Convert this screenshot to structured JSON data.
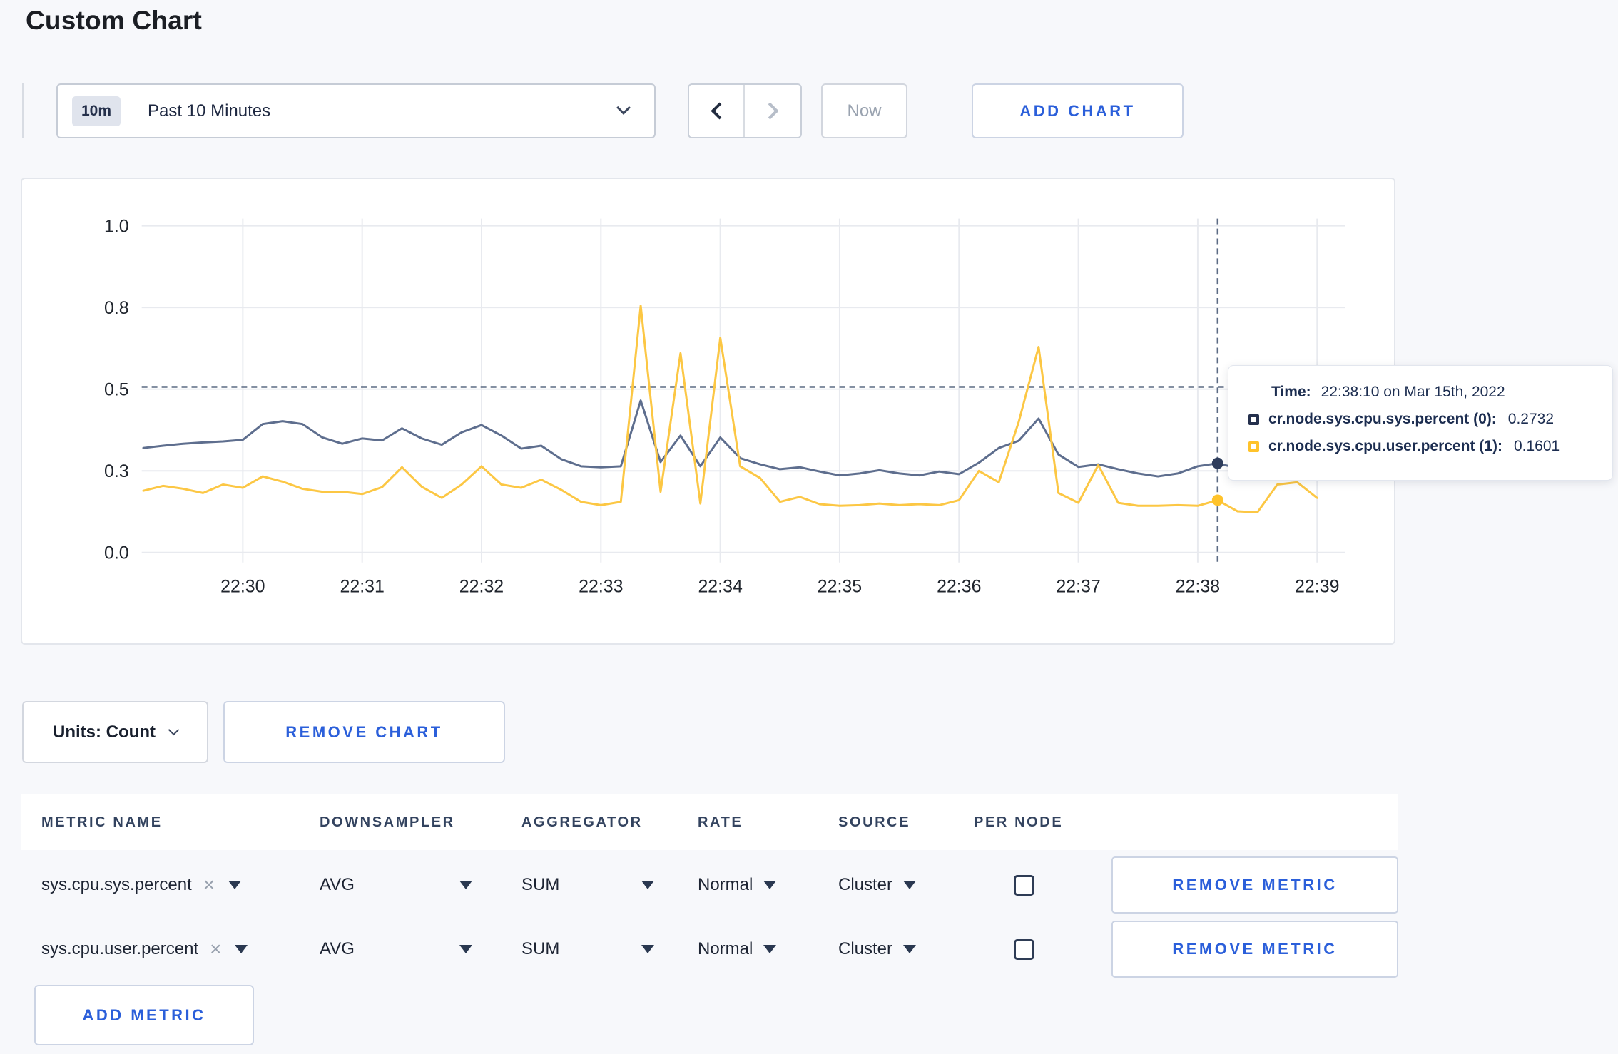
{
  "page": {
    "title": "Custom Chart"
  },
  "toolbar": {
    "time_window_badge": "10m",
    "time_window_label": "Past 10 Minutes",
    "now_label": "Now",
    "add_chart_label": "ADD CHART"
  },
  "chart_controls": {
    "units_label": "Units: Count",
    "remove_chart_label": "REMOVE CHART"
  },
  "tooltip": {
    "time_label": "Time:",
    "time_value": "22:38:10 on Mar 15th, 2022",
    "series": [
      {
        "name": "cr.node.sys.cpu.sys.percent (0):",
        "value": "0.2732",
        "color": "#25304d"
      },
      {
        "name": "cr.node.sys.cpu.user.percent (1):",
        "value": "0.1601",
        "color": "#ffc32b"
      }
    ]
  },
  "chart_data": {
    "type": "line",
    "title": "",
    "xlabel": "",
    "ylabel": "",
    "ylim": [
      0,
      1
    ],
    "grid": true,
    "legend": "tooltip-overlay",
    "x_ticks": [
      "22:30",
      "22:31",
      "22:32",
      "22:33",
      "22:34",
      "22:35",
      "22:36",
      "22:37",
      "22:38",
      "22:39"
    ],
    "y_tick_labels": [
      "0.0",
      "0.3",
      "0.5",
      "0.8",
      "1.0"
    ],
    "y_tick_values": [
      0,
      0.25,
      0.5,
      0.75,
      1.0
    ],
    "x_start": "22:29:10",
    "start_offset_seconds": -50,
    "interval_seconds": 10,
    "series": [
      {
        "name": "cr.node.sys.cpu.sys.percent (0)",
        "color": "#5e6e8e",
        "marker_color": "#2f3d5c",
        "values": [
          0.32,
          0.327,
          0.333,
          0.337,
          0.34,
          0.345,
          0.393,
          0.402,
          0.393,
          0.352,
          0.333,
          0.349,
          0.343,
          0.38,
          0.349,
          0.33,
          0.368,
          0.39,
          0.358,
          0.318,
          0.327,
          0.286,
          0.264,
          0.261,
          0.264,
          0.465,
          0.277,
          0.358,
          0.264,
          0.352,
          0.289,
          0.27,
          0.255,
          0.261,
          0.248,
          0.236,
          0.242,
          0.252,
          0.242,
          0.236,
          0.248,
          0.24,
          0.275,
          0.32,
          0.342,
          0.41,
          0.3,
          0.262,
          0.27,
          0.255,
          0.242,
          0.233,
          0.242,
          0.264,
          0.2732,
          0.258
        ]
      },
      {
        "name": "cr.node.sys.cpu.user.percent (1)",
        "color": "#fcc744",
        "marker_color": "#ffc32b",
        "values": [
          0.189,
          0.204,
          0.195,
          0.182,
          0.208,
          0.198,
          0.233,
          0.217,
          0.195,
          0.186,
          0.186,
          0.179,
          0.2,
          0.261,
          0.201,
          0.167,
          0.208,
          0.264,
          0.208,
          0.198,
          0.223,
          0.192,
          0.155,
          0.145,
          0.155,
          0.755,
          0.186,
          0.61,
          0.15,
          0.657,
          0.264,
          0.228,
          0.155,
          0.17,
          0.148,
          0.143,
          0.145,
          0.15,
          0.145,
          0.148,
          0.145,
          0.16,
          0.25,
          0.215,
          0.4,
          0.629,
          0.182,
          0.152,
          0.268,
          0.152,
          0.143,
          0.143,
          0.145,
          0.143,
          0.1601,
          0.126,
          0.123,
          0.208,
          0.215,
          0.167
        ]
      }
    ],
    "crosshair": {
      "index": 54,
      "time": "22:38:10",
      "cursor_y_value": 0.507,
      "points": [
        {
          "series": 0,
          "value": 0.2732
        },
        {
          "series": 1,
          "value": 0.1601
        }
      ]
    }
  },
  "metrics_table": {
    "headers": [
      "METRIC NAME",
      "DOWNSAMPLER",
      "AGGREGATOR",
      "RATE",
      "SOURCE",
      "PER NODE"
    ],
    "rows": [
      {
        "metric": "sys.cpu.sys.percent",
        "downsampler": "AVG",
        "aggregator": "SUM",
        "rate": "Normal",
        "source": "Cluster",
        "per_node_checked": false,
        "remove_label": "REMOVE METRIC"
      },
      {
        "metric": "sys.cpu.user.percent",
        "downsampler": "AVG",
        "aggregator": "SUM",
        "rate": "Normal",
        "source": "Cluster",
        "per_node_checked": false,
        "remove_label": "REMOVE METRIC"
      }
    ],
    "add_metric_label": "ADD METRIC"
  },
  "icons": {
    "close": "×"
  }
}
